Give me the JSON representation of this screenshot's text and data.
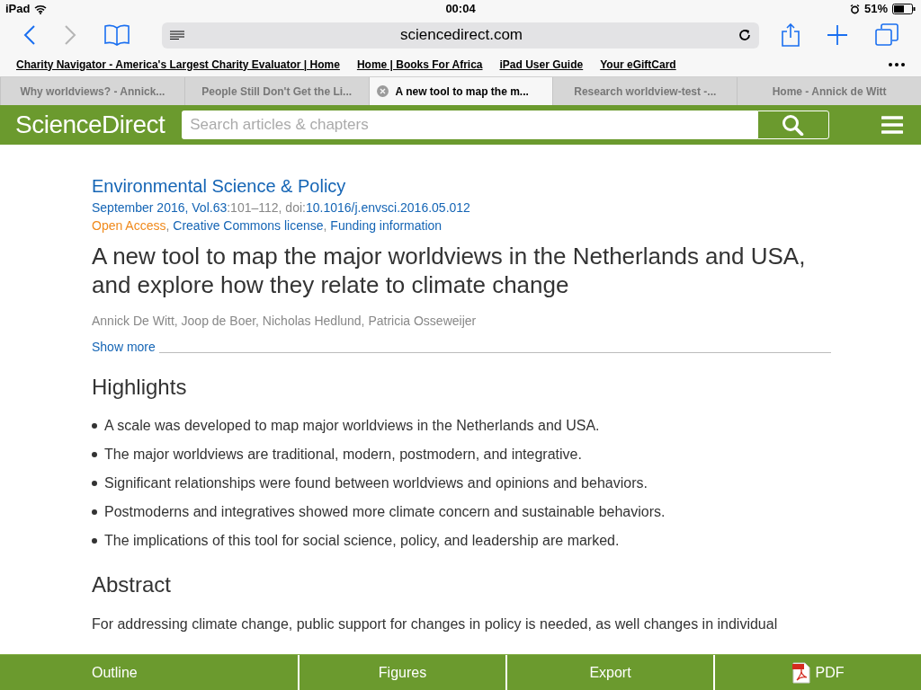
{
  "status_bar": {
    "device": "iPad",
    "time": "00:04",
    "battery": "51%"
  },
  "browser": {
    "address": "sciencedirect.com"
  },
  "bookmarks": [
    "Charity Navigator - America's Largest Charity Evaluator | Home",
    "Home | Books For Africa",
    "iPad User Guide",
    "Your eGiftCard"
  ],
  "tabs": [
    {
      "label": "Why worldviews? - Annick...",
      "selected": false
    },
    {
      "label": "People Still Don't Get the Li...",
      "selected": false
    },
    {
      "label": "A new tool to map the m...",
      "selected": true
    },
    {
      "label": "Research worldview-test -...",
      "selected": false
    },
    {
      "label": "Home - Annick de Witt",
      "selected": false
    }
  ],
  "site_header": {
    "logo": "ScienceDirect",
    "search": {
      "placeholder": "Search articles & chapters"
    }
  },
  "article": {
    "journal": "Environmental Science & Policy",
    "citation": [
      {
        "text": "September 2016, Vol.63",
        "kind": "link"
      },
      {
        "text": ":101–112, doi:",
        "kind": "plain"
      },
      {
        "text": "10.1016/j.envsci.2016.05.012",
        "kind": "link"
      }
    ],
    "access": [
      {
        "text": "Open Access",
        "kind": "open"
      },
      {
        "text": ", ",
        "kind": "plain"
      },
      {
        "text": "Creative Commons license",
        "kind": "link"
      },
      {
        "text": ", ",
        "kind": "plain"
      },
      {
        "text": "Funding information",
        "kind": "link"
      }
    ],
    "title": "A new tool to map the major worldviews in the Netherlands and USA, and explore how they relate to climate change",
    "authors": "Annick De Witt, Joop de Boer, Nicholas Hedlund, Patricia Osseweijer",
    "show_more": "Show more",
    "highlights_heading": "Highlights",
    "highlights": [
      "A scale was developed to map major worldviews in the Netherlands and USA.",
      "The major worldviews are traditional, modern, postmodern, and integrative.",
      "Significant relationships were found between worldviews and opinions and behaviors.",
      "Postmoderns and integratives showed more climate concern and sustainable behaviors.",
      "The implications of this tool for social science, policy, and leadership are marked."
    ],
    "abstract_heading": "Abstract",
    "abstract": "For addressing climate change, public support for changes in policy is needed, as well changes in individual"
  },
  "bottom_bar": [
    {
      "label": "Outline",
      "kind": "text"
    },
    {
      "label": "Figures",
      "kind": "text"
    },
    {
      "label": "Export",
      "kind": "text"
    },
    {
      "label": "PDF",
      "kind": "pdf"
    }
  ]
}
